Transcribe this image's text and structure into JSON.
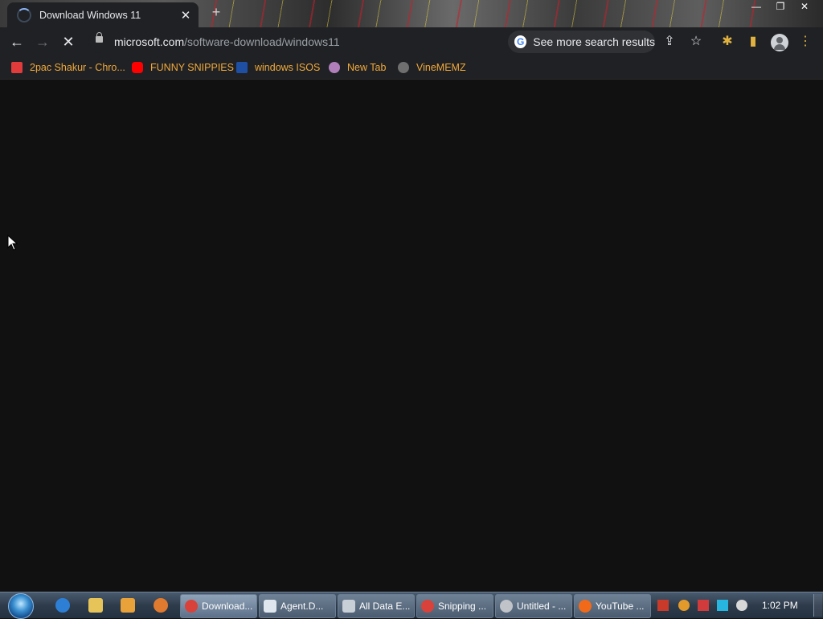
{
  "tab": {
    "title": "Download Windows 11",
    "close": "✕",
    "new_tab": "+"
  },
  "window_controls": {
    "minimize": "—",
    "maximize": "❐",
    "close": "✕"
  },
  "toolbar": {
    "back": "←",
    "forward": "→",
    "reload": "✕",
    "url_host": "microsoft.com",
    "url_path": "/software-download/windows11",
    "search_chip": "See more search results",
    "search_chip_icon": "G",
    "share": "⇪",
    "star": "☆",
    "extensions": "✱",
    "sidepanel": "▮",
    "menu": "⋮"
  },
  "bookmarks": [
    {
      "label": "2pac Shakur - Chro...",
      "icon": "2pac-icon",
      "color": "#e23b3b"
    },
    {
      "label": "FUNNY SNIPPIES",
      "icon": "youtube-icon",
      "color": "#ff0000"
    },
    {
      "label": "windows ISOS",
      "icon": "weather-channel-icon",
      "color": "#1f4fa3"
    },
    {
      "label": "New Tab",
      "icon": "chrome-newtab-icon",
      "color": "#b07fb9"
    },
    {
      "label": "VineMEMZ",
      "icon": "globe-icon",
      "color": "#6f6f6f"
    }
  ],
  "taskbar": {
    "buttons": [
      {
        "label": "Download...",
        "icon": "chrome-icon",
        "color": "#d9423a"
      },
      {
        "label": "Agent.D...",
        "icon": "window-icon",
        "color": "#dfe6ee"
      },
      {
        "label": "All Data E...",
        "icon": "folder-window-icon",
        "color": "#c9cfd6"
      },
      {
        "label": "Snipping ...",
        "icon": "snipping-tool-icon",
        "color": "#d9423a"
      },
      {
        "label": "Untitled - ...",
        "icon": "paint-icon",
        "color": "#c0c4c9"
      },
      {
        "label": "YouTube ...",
        "icon": "firefox-icon",
        "color": "#f06a1a"
      }
    ],
    "clock": "1:02 PM"
  }
}
